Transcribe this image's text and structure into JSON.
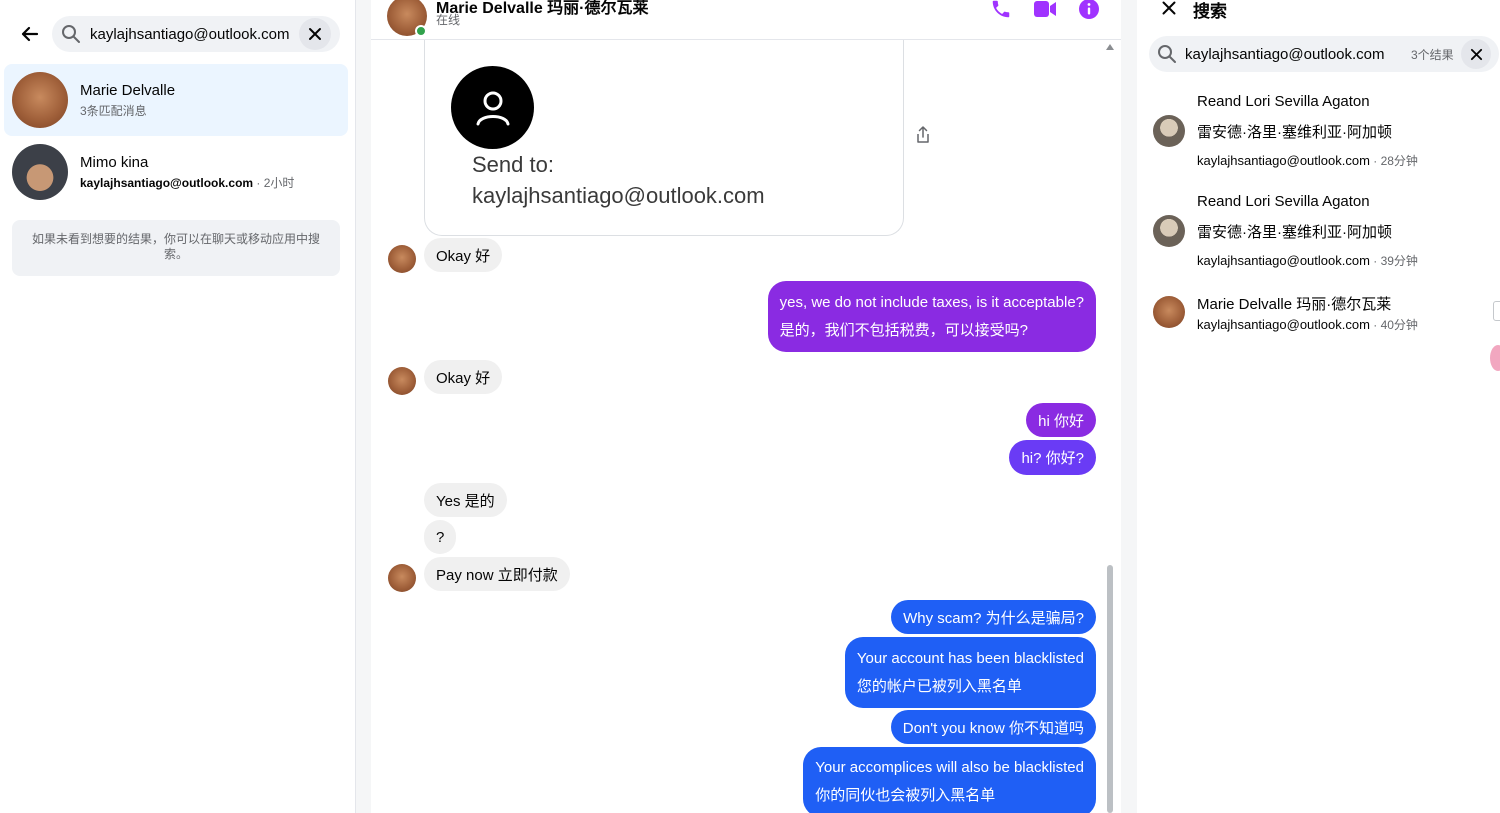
{
  "left": {
    "search_value": "kaylajhsantiago@outlook.com",
    "conversations": [
      {
        "name": "Marie Delvalle",
        "sub": "3条匹配消息"
      },
      {
        "name": "Mimo kina",
        "email": "kaylajhsantiago@outlook.com",
        "time": " · 2小时"
      }
    ],
    "hint": "如果未看到想要的结果，你可以在聊天或移动应用中搜索。"
  },
  "chat": {
    "header": {
      "name": "Marie Delvalle  玛丽·德尔瓦莱",
      "status": "在线"
    },
    "image_card": {
      "send_to": "Send to:",
      "email": "kaylajhsantiago@outlook.com"
    },
    "messages": [
      {
        "text": "Okay  好"
      },
      {
        "line1": "yes, we do not include taxes, is it acceptable?",
        "line2": "是的，我们不包括税费，可以接受吗?"
      },
      {
        "text": "Okay  好"
      },
      {
        "text": "hi  你好"
      },
      {
        "text": "hi?  你好?"
      },
      {
        "text": "Yes  是的"
      },
      {
        "text": "?"
      },
      {
        "text": "Pay now  立即付款"
      },
      {
        "text": "Why scam?  为什么是骗局?"
      },
      {
        "line1": "Your account has been blacklisted",
        "line2": "您的帐户已被列入黑名单"
      },
      {
        "text": "Don't you know  你不知道吗"
      },
      {
        "line1": "Your accomplices will also be blacklisted",
        "line2": "你的同伙也会被列入黑名单"
      }
    ]
  },
  "right": {
    "title": "搜索",
    "query": "kaylajhsantiago@outlook.com",
    "count": "3个结果",
    "results": [
      {
        "name": "Reand Lori Sevilla Agaton",
        "name2": "雷安德·洛里·塞维利亚·阿加顿",
        "email": "kaylajhsantiago@outlook.com",
        "time": " · 28分钟"
      },
      {
        "name": "Reand Lori Sevilla Agaton",
        "name2": "雷安德·洛里·塞维利亚·阿加顿",
        "email": "kaylajhsantiago@outlook.com",
        "time": " · 39分钟"
      },
      {
        "name": "Marie Delvalle  玛丽·德尔瓦莱",
        "email": "kaylajhsantiago@outlook.com",
        "time": " · 40分钟"
      }
    ]
  },
  "colors": {
    "accent": "#a033ff",
    "bubble_purple": "#8a2be2",
    "bubble_violet": "#6a3bf5",
    "bubble_blue": "#1f5ff5",
    "online": "#31a24c",
    "active_row": "#ebf5ff"
  },
  "icons": [
    "back-arrow-icon",
    "search-icon",
    "close-icon",
    "phone-icon",
    "video-icon",
    "info-icon",
    "user-icon",
    "share-icon"
  ]
}
